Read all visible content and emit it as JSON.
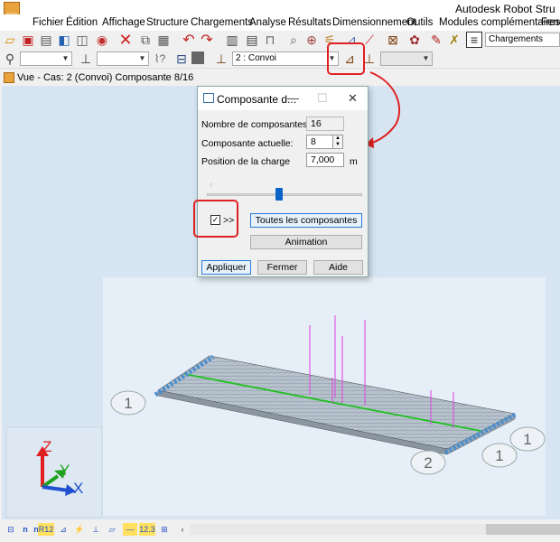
{
  "app": {
    "title": "Autodesk Robot Stru",
    "logo": "RBD"
  },
  "menu": [
    "Fichier",
    "Édition",
    "Affichage",
    "Structure",
    "Chargements",
    "Analyse",
    "Résultats",
    "Dimensionnement",
    "Outils",
    "Modules complémentaires",
    "Fenê"
  ],
  "toolbar": {
    "chargements_label": "Chargements",
    "case_combo_value": "2 : Convoi",
    "icons": [
      "new-icon",
      "save-icon",
      "print-icon",
      "open-icon",
      "print-preview-icon",
      "screen-capture-icon",
      "delete-icon",
      "copy-icon",
      "paste-icon",
      "undo-icon",
      "redo-icon",
      "tables-icon",
      "calc-icon",
      "lock-icon",
      "zoom-icon",
      "zoom-all-icon",
      "loads-icon",
      "structure-icon",
      "member-icon",
      "section-icon",
      "settings-icon",
      "edit-icon",
      "layout-icon"
    ]
  },
  "view": {
    "title": "Vue - Cas: 2 (Convoi) Composante 8/16",
    "node_labels": [
      "1",
      "1",
      "2",
      "1"
    ]
  },
  "dialog": {
    "title": "Composante d...",
    "nb_label": "Nombre de composantes:",
    "nb_value": "16",
    "current_label": "Composante actuelle:",
    "current_value": "8",
    "position_label": "Position de la charge",
    "position_value": "7,000",
    "position_unit": "m",
    "slider_value": 0.5,
    "checkbox_label": ">>",
    "checkbox_checked": true,
    "btn_all": "Toutes les composantes",
    "btn_animation": "Animation",
    "btn_apply": "Appliquer",
    "btn_close": "Fermer",
    "btn_help": "Aide"
  },
  "axes": {
    "x": "X",
    "y": "Y",
    "z": "Z"
  },
  "bottom_icons": [
    "view-2d-icon",
    "view-3d-icon",
    "node-num-icon",
    "bar-num-icon",
    "supports-icon",
    "loads-display-icon",
    "sections-icon",
    "panels-icon",
    "values-icon",
    "deformation-icon"
  ],
  "bottom_labels": [
    "n",
    "n",
    "R12",
    "12.3"
  ],
  "colors": {
    "accent": "#0a64c8",
    "annotation": "#e02020",
    "viewport": "#d7e5f2",
    "beam_green": "#20c020",
    "load_magenta": "#e040e0",
    "support_blue": "#4a8fd0"
  }
}
